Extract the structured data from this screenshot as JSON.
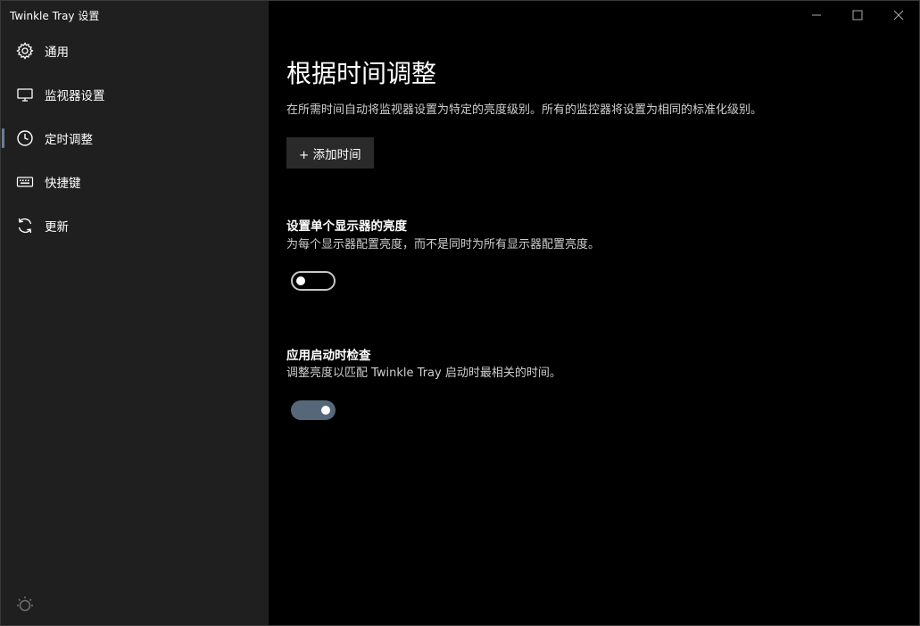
{
  "app": {
    "title": "Twinkle Tray 设置"
  },
  "sidebar": {
    "items": [
      {
        "label": "通用",
        "icon": "gear-icon"
      },
      {
        "label": "监视器设置",
        "icon": "monitor-icon"
      },
      {
        "label": "定时调整",
        "icon": "clock-icon",
        "active": true
      },
      {
        "label": "快捷键",
        "icon": "keyboard-icon"
      },
      {
        "label": "更新",
        "icon": "refresh-icon"
      }
    ],
    "bottom_icon": "sun-icon"
  },
  "window_controls": [
    "minimize-icon",
    "maximize-icon",
    "close-icon"
  ],
  "main": {
    "title": "根据时间调整",
    "description": "在所需时间自动将监视器设置为特定的亮度级别。所有的监控器将设置为相同的标准化级别。",
    "add_button": "+ 添加时间",
    "sections": [
      {
        "title": "设置单个显示器的亮度",
        "description": "为每个显示器配置亮度，而不是同时为所有显示器配置亮度。",
        "toggle_on": false
      },
      {
        "title": "应用启动时检查",
        "description": "调整亮度以匹配 Twinkle Tray 启动时最相关的时间。",
        "toggle_on": true
      }
    ]
  },
  "colors": {
    "sidebar_bg": "#1f1f1f",
    "main_bg": "#000000",
    "accent": "#56677a"
  }
}
